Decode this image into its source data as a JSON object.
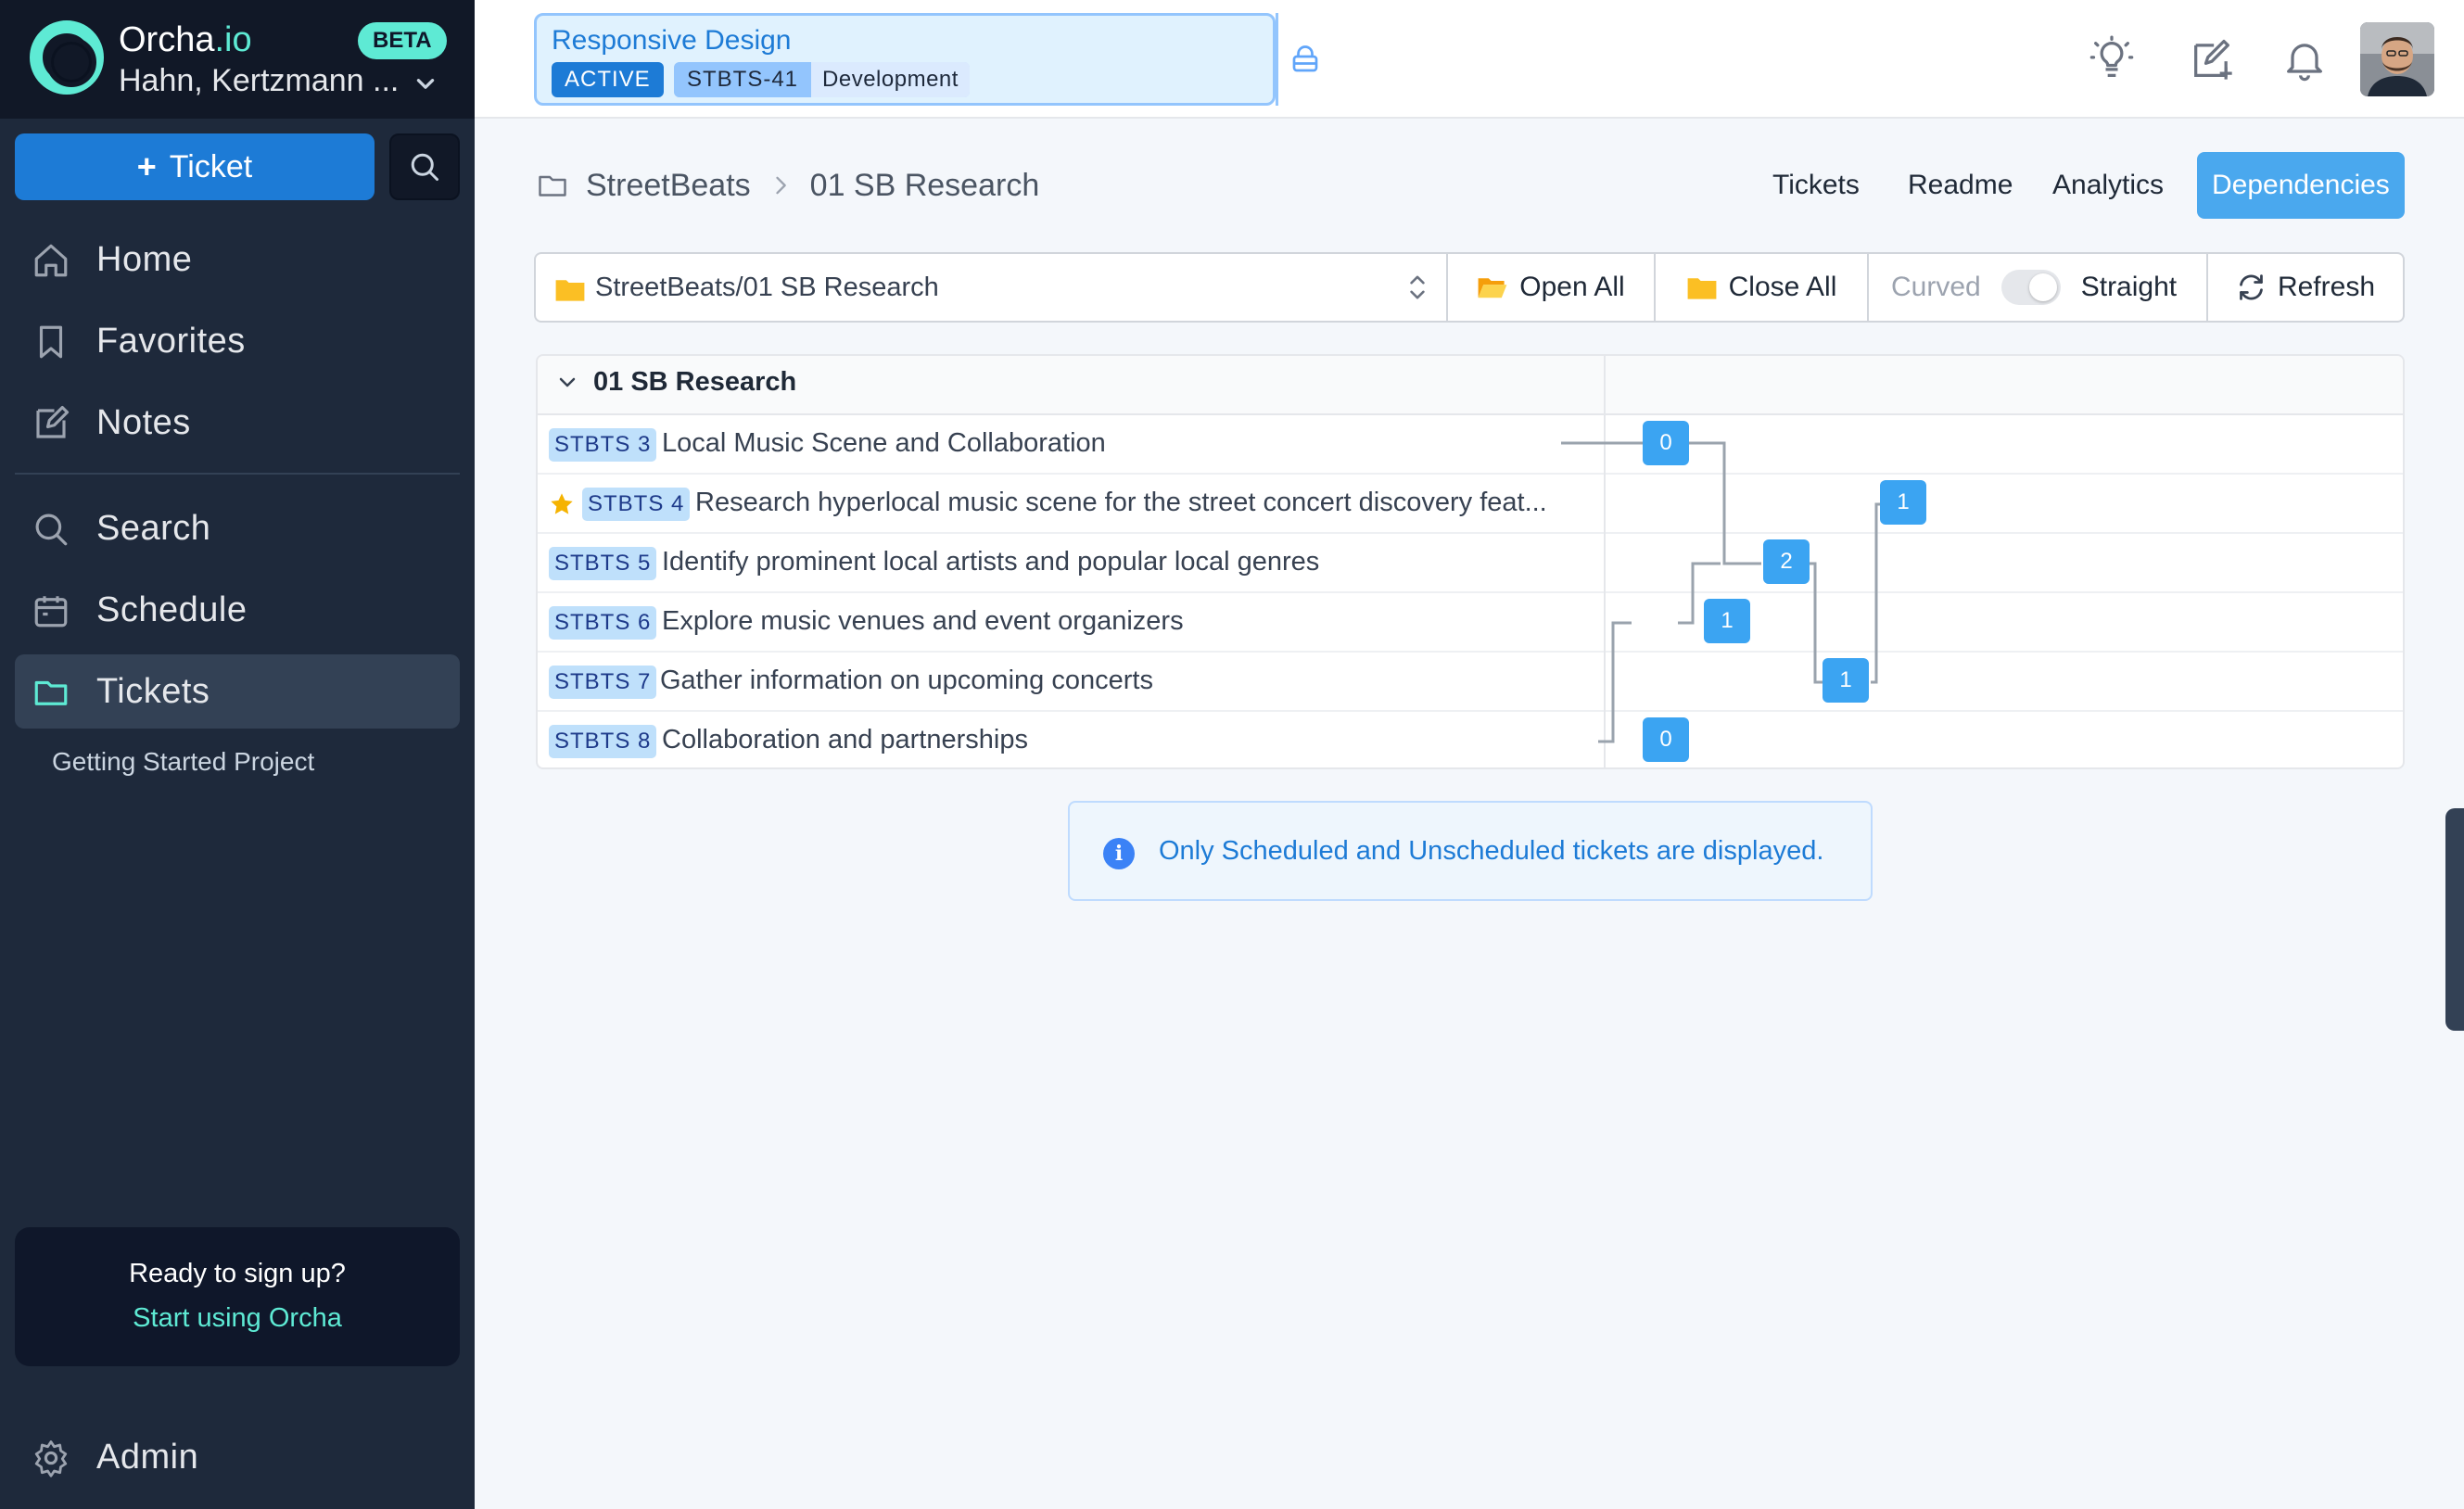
{
  "brand": {
    "name_main": "Orcha",
    "name_suffix": ".io",
    "badge": "BETA",
    "org": "Hahn, Kertzmann ..."
  },
  "sidebar": {
    "new_ticket_label": "Ticket",
    "items": [
      {
        "label": "Home",
        "icon": "home-icon"
      },
      {
        "label": "Favorites",
        "icon": "bookmark-icon"
      },
      {
        "label": "Notes",
        "icon": "edit-icon"
      },
      {
        "label": "Search",
        "icon": "search-icon"
      },
      {
        "label": "Schedule",
        "icon": "calendar-icon"
      },
      {
        "label": "Tickets",
        "icon": "folder-icon",
        "active": true
      }
    ],
    "sub_item": "Getting Started Project",
    "signup": {
      "title": "Ready to sign up?",
      "link": "Start using Orcha"
    },
    "admin_label": "Admin"
  },
  "header": {
    "project_title": "Responsive Design",
    "status": "ACTIVE",
    "ticket_key": "STBTS-41",
    "ticket_type": "Development",
    "icons": [
      "lightbulb-icon",
      "compose-icon",
      "bell-icon",
      "avatar"
    ]
  },
  "breadcrumb": {
    "root": "StreetBeats",
    "current": "01 SB Research"
  },
  "view_tabs": [
    {
      "label": "Tickets"
    },
    {
      "label": "Readme"
    },
    {
      "label": "Analytics"
    },
    {
      "label": "Dependencies",
      "active": true
    }
  ],
  "toolbar": {
    "path": "StreetBeats/01 SB Research",
    "open_all": "Open All",
    "close_all": "Close All",
    "curved": "Curved",
    "straight": "Straight",
    "refresh": "Refresh"
  },
  "tree": {
    "group": "01 SB Research",
    "rows": [
      {
        "key": "STBTS 3",
        "title": "Local Music Scene and Collaboration",
        "starred": false,
        "deps": "0"
      },
      {
        "key": "STBTS 4",
        "title": "Research hyperlocal music scene for the street concert discovery feat...",
        "starred": true,
        "deps": "1"
      },
      {
        "key": "STBTS 5",
        "title": "Identify prominent local artists and popular local genres",
        "starred": false,
        "deps": "2"
      },
      {
        "key": "STBTS 6",
        "title": "Explore music venues and event organizers",
        "starred": false,
        "deps": "1"
      },
      {
        "key": "STBTS 7",
        "title": "Gather information on upcoming concerts",
        "starred": false,
        "deps": "1"
      },
      {
        "key": "STBTS 8",
        "title": "Collaboration and partnerships",
        "starred": false,
        "deps": "0"
      }
    ]
  },
  "info": {
    "message": "Only Scheduled and Unscheduled tickets are displayed."
  },
  "colors": {
    "sidebar_bg": "#1e293b",
    "accent": "#1d7bd6",
    "teal": "#5eead4",
    "node_blue": "#3ba4f2"
  }
}
